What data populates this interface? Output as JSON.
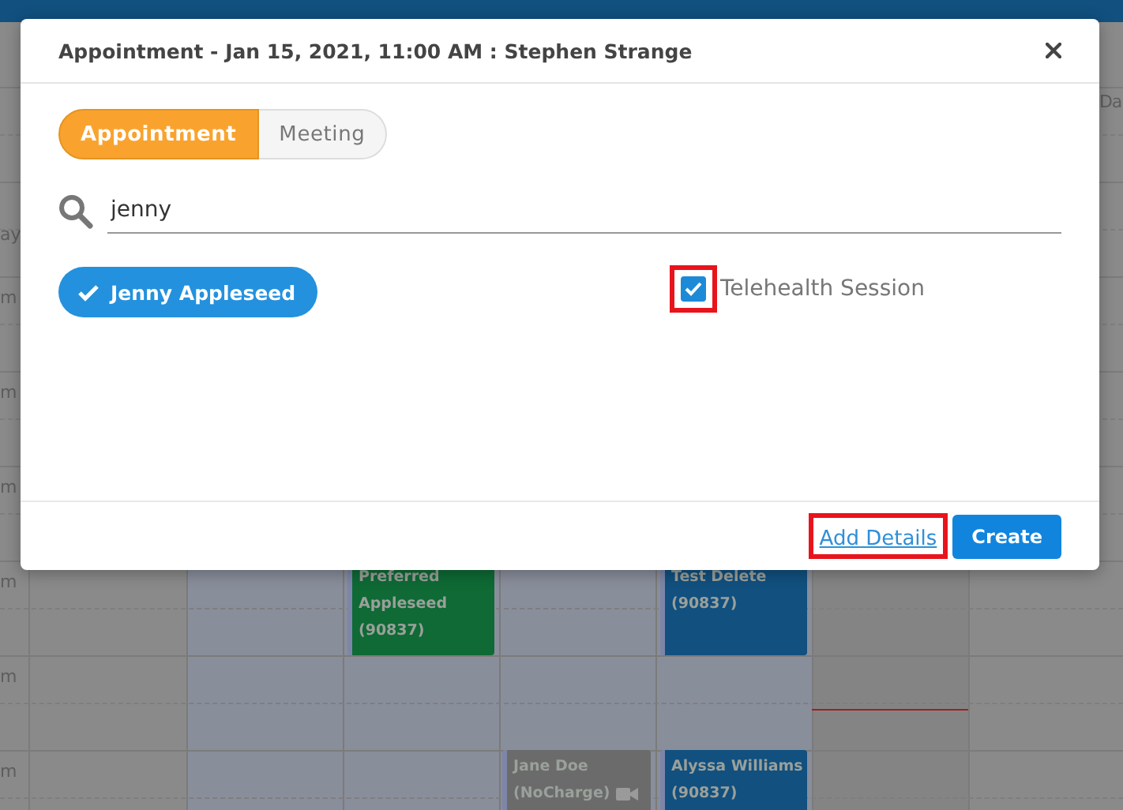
{
  "calendar": {
    "header_fragment": "Da",
    "day_fragment": "ay",
    "time_fragments": [
      "m",
      "m",
      "m",
      "m",
      "m",
      "m"
    ],
    "events": [
      {
        "lines": [
          "Preferred",
          "Appleseed",
          "(90837)"
        ],
        "color": "#0f6a35",
        "video": false
      },
      {
        "lines": [
          "Test Delete",
          "(90837)"
        ],
        "color": "#11507f",
        "video": false
      },
      {
        "lines": [
          "Jane Doe",
          "(NoCharge)"
        ],
        "color": "#6b6b6b",
        "video": true
      },
      {
        "lines": [
          "Alyssa Williams",
          "(90837)"
        ],
        "color": "#11507f",
        "video": false
      }
    ]
  },
  "dialog": {
    "title": "Appointment - Jan 15, 2021, 11:00 AM : Stephen Strange",
    "tabs": [
      {
        "label": "Appointment",
        "selected": true
      },
      {
        "label": "Meeting",
        "selected": false
      }
    ],
    "search": {
      "value": "jenny"
    },
    "selected_clients": [
      {
        "name": "Jenny Appleseed"
      }
    ],
    "telehealth": {
      "label": "Telehealth Session",
      "checked": true,
      "highlighted": true
    },
    "add_details": {
      "label": "Add Details",
      "highlighted": true
    },
    "buttons": [
      "Create"
    ]
  }
}
